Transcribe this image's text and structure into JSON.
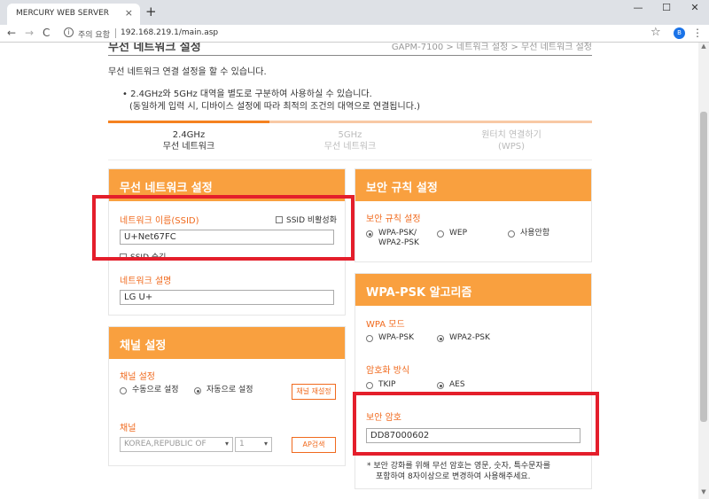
{
  "browser": {
    "tab_title": "MERCURY WEB SERVER",
    "tab_close": "×",
    "new_tab": "+",
    "win_min": "—",
    "win_max": "☐",
    "win_close": "✕",
    "back": "←",
    "forward": "→",
    "reload": "C",
    "security_text": "주의 요함",
    "url": "192.168.219.1/main.asp",
    "star": "☆",
    "profile": "B",
    "menu": "⋮"
  },
  "page": {
    "title": "무선 네트워크 설정",
    "breadcrumb": "GAPM-7100 > 네트워크 설정 > 무선 네트워크 설정",
    "intro": "무선 네트워크 연결 설정을 할 수 있습니다.",
    "note_line1": "• 2.4GHz와 5GHz 대역을 별도로 구분하여 사용하실 수 있습니다.",
    "note_line2": "(동일하게 입력 시, 디바이스 설정에 따라 최적의 조건의 대역으로 연결됩니다.)"
  },
  "tabs": [
    {
      "line1": "2.4GHz",
      "line2": "무선 네트워크"
    },
    {
      "line1": "5GHz",
      "line2": "무선 네트워크"
    },
    {
      "line1": "원터치 연결하기",
      "line2": "(WPS)"
    }
  ],
  "wireless": {
    "header": "무선 네트워크 설정",
    "ssid_label": "네트워크 이름(SSID)",
    "ssid_disable_label": "SSID 비활성화",
    "ssid_value": "U+Net67FC",
    "ssid_hide_label": "SSID 숨김",
    "desc_label": "네트워크 설명",
    "desc_value": "LG U+"
  },
  "channel": {
    "header": "채널 설정",
    "setting_label": "채널 설정",
    "manual_label": "수동으로 설정",
    "auto_label": "자동으로 설정",
    "reset_button": "채널 재설정",
    "channel_label": "채널",
    "country_value": "KOREA,REPUBLIC OF",
    "channel_value": "1",
    "ap_scan_button": "AP검색"
  },
  "security": {
    "header": "보안 규칙 설정",
    "rule_label": "보안 규칙 설정",
    "option_wpa_line1": "WPA-PSK/",
    "option_wpa_line2": "WPA2-PSK",
    "option_wep": "WEP",
    "option_none": "사용안함"
  },
  "wpa": {
    "header": "WPA-PSK 알고리즘",
    "mode_label": "WPA 모드",
    "mode_wpa": "WPA-PSK",
    "mode_wpa2": "WPA2-PSK",
    "enc_label": "암호화 방식",
    "enc_tkip": "TKIP",
    "enc_aes": "AES",
    "key_label": "보안 암호",
    "key_value": "DD87000602",
    "footnote1": "* 보안 강화를 위해 무선 암호는 영문, 숫자, 특수문자를",
    "footnote2": "포함하여 8자이상으로 변경하여 사용해주세요."
  },
  "colors": {
    "accent_orange": "#f9a03f",
    "label_orange": "#f06a1e",
    "highlight_red": "#e41e2b"
  }
}
